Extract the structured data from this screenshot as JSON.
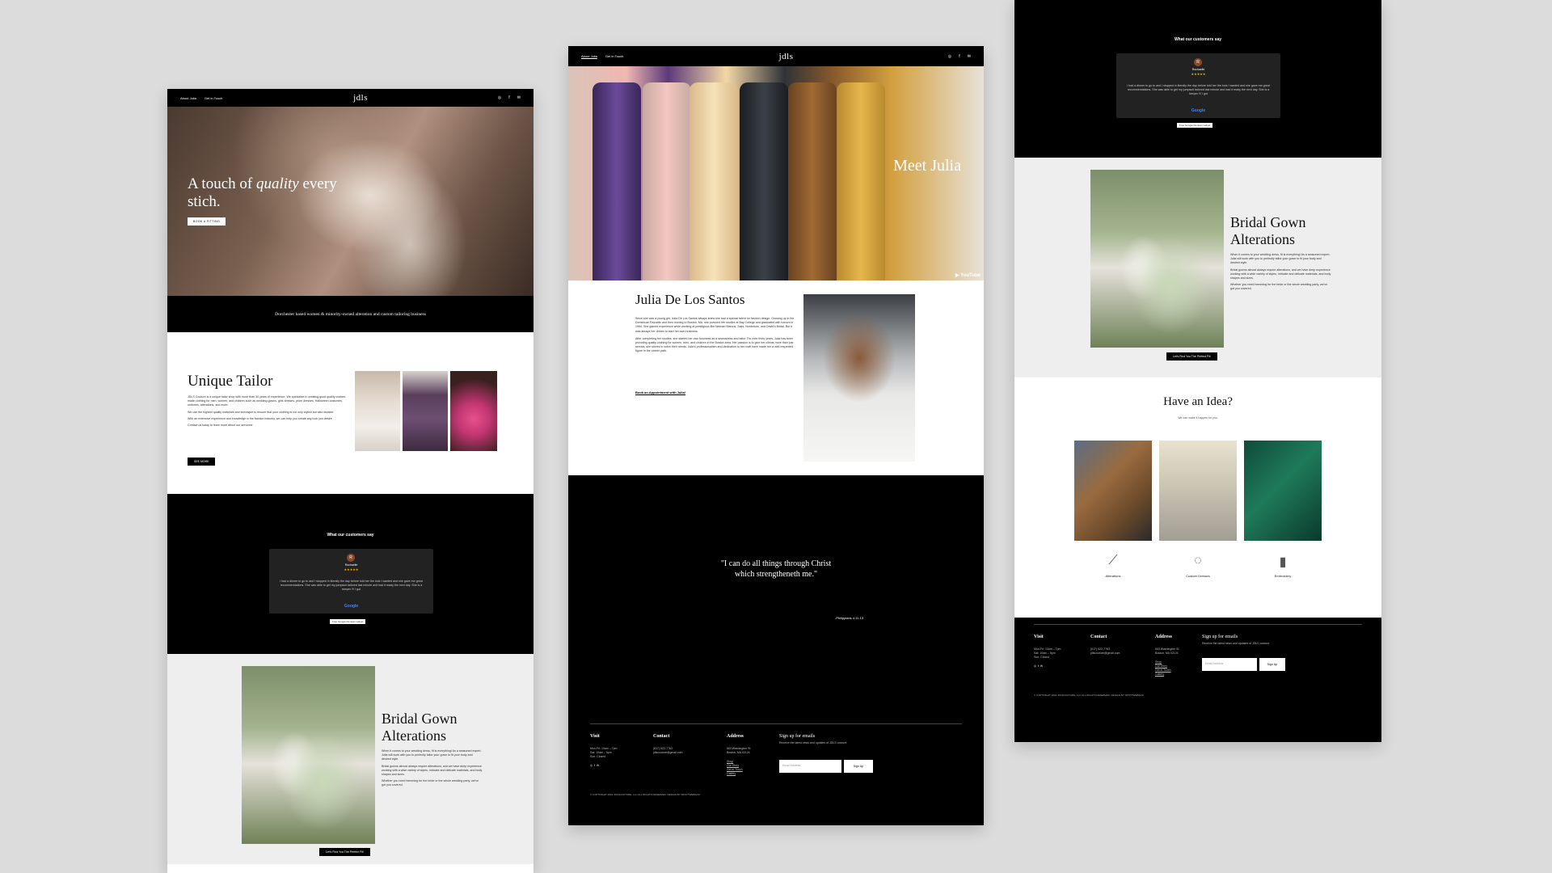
{
  "nav": {
    "logo": "jdls",
    "about": "About Julia",
    "contact": "Get in Touch",
    "icons": [
      "instagram-icon",
      "facebook-icon",
      "email-icon"
    ]
  },
  "left": {
    "hero_line1_a": "A touch of ",
    "hero_line1_b": "quality",
    "hero_line1_c": " every",
    "hero_line2": "stich.",
    "hero_button": "BOOK A FITTING",
    "tagline": "Dorchester based women & minority-owned alteration and custom tailoring business",
    "tailor_title": "Unique Tailor",
    "tailor_p1": "JDLS Couture is a unique tailor shop with more than 30 years of experience. We specialize in creating good quality custom-made clothing for men, women, and children such as wedding gowns, girls dresses, prom dresses, Halloween costumes, uniforms, alterations, and more.",
    "tailor_p2": "We use the highest quality materials and technique to ensure that your clothing is not only stylish but also durable.",
    "tailor_p3": "With an extensive experience and knowledge in the fashion industry, we can help you create any look you desire.",
    "tailor_p4": "Contact us today to learn more about our services!",
    "tailor_button": "SEE MORE",
    "reviews_title": "What our customers say",
    "reviewer": "Rochaelle",
    "stars": "★★★★★",
    "review_text": "I had a dinner to go to and I stopped in literally the day before told her the look I wanted and she gave me great recommendations. She was able to get my jumpsuit tailored last minute and had it ready the next day. She is a keeper !!! I got",
    "google": "Google",
    "badge": "Free Google Reviews widget",
    "bridal_title_1": "Bridal Gown",
    "bridal_title_2": "Alterations",
    "bridal_p1": "When it comes to your wedding dress, fit is everything! As a seasoned expert, Julia will work with you to perfectly tailor your gown to fit your body and desired style.",
    "bridal_p2": "Bridal gowns almost always require alterations, and we have deep experience working with a wide variety of styles, intricate and delicate materials, and body shapes and sizes.",
    "bridal_p3": "Whether you need hemming for the bride or the whole wedding party, we've got you covered.",
    "bridal_button": "Let's Find You The Perfect Fit!"
  },
  "mid": {
    "hero_title": "Meet Julia",
    "youtube": "YouTube",
    "name": "Julia De Los Santos",
    "bio_p1": "Since she was a young girl, Julia De Los Santos always knew she had a special talent for fashion design. Growing up in the Dominican Republic and then moving to Boston, MA, she pursued her studies at Bay College and graduated with honors in 1994. She gained experience while working at prestigious like Neiman Marcus, Saks, Nordstrom, and David's Bridal. But it was always her dream to start her own business.",
    "bio_p2": "After completing her studies, she started her own business as a seamstress and tailor. For over thirty years, Julia has been providing quality clothing for women, men, and children in the Boston area. Her passion is to give her clients more than just service; she strives to solve their needs. Julia's professionalism and dedication to her craft have made her a well-respected figure in the career path.",
    "book_link": "Book an Appointment with Julia!",
    "verse_1": "\"I can do all things through Christ",
    "verse_2": "which strengtheneth me.\"",
    "verse_ref": "-Philippians 4:11-13",
    "footer": {
      "visit_h": "Visit",
      "visit_1": "Mon-Fri: 10am – 7pm",
      "visit_2": "Sat: 10am – 5pm",
      "visit_3": "Sun: Closed",
      "contact_h": "Contact",
      "contact_1": "(617) 522-7763",
      "contact_2": "jdlscouture@gmail.com",
      "address_h": "Address",
      "address_1": "663 Washington St",
      "address_2": "Boston, MA 02124",
      "address_3": "Shop",
      "address_4": "Our Story",
      "address_5": "Get in Touch",
      "address_6": "Gallery",
      "signup_h": "Sign up for emails",
      "signup_sub": "Receive the latest news and updates of JDLS couture.",
      "email_placeholder": "Email Address",
      "signup_btn": "Sign Up",
      "copyright": "© COPYRIGHT 2022 JDLSCOUTURE, LLC ALL RIGHTS RESERVED. DESIGN BY SPOTTWEBACD"
    }
  },
  "right": {
    "idea_title": "Have an Idea?",
    "idea_sub": "We can make it happen for you.",
    "services": [
      "Alterations",
      "Custom Dresses",
      "Embroidery"
    ]
  }
}
